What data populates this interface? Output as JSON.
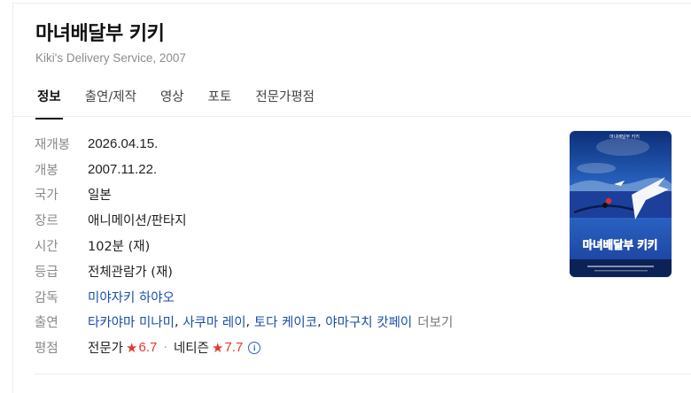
{
  "movie": {
    "title": "마녀배달부 키키",
    "subtitle": "Kiki's Delivery Service, 2007"
  },
  "tabs": [
    {
      "label": "정보",
      "active": true
    },
    {
      "label": "출연/제작",
      "active": false
    },
    {
      "label": "영상",
      "active": false
    },
    {
      "label": "포토",
      "active": false
    },
    {
      "label": "전문가평점",
      "active": false
    }
  ],
  "info": {
    "rerelease": {
      "label": "재개봉",
      "value": "2026.04.15."
    },
    "release": {
      "label": "개봉",
      "value": "2007.11.22."
    },
    "country": {
      "label": "국가",
      "value": "일본"
    },
    "genre": {
      "label": "장르",
      "value": "애니메이션/판타지"
    },
    "runtime": {
      "label": "시간",
      "value": "102분 (재)"
    },
    "rating": {
      "label": "등급",
      "value": "전체관람가 (재)"
    },
    "director": {
      "label": "감독",
      "value": "미야자키 하야오"
    },
    "cast": {
      "label": "출연",
      "names": [
        "타카야마 미나미",
        "사쿠마 레이",
        "토다 케이코",
        "야마구치 캇페이"
      ],
      "separator": ", ",
      "more": "더보기"
    },
    "scores": {
      "label": "평점",
      "critic_label": "전문가",
      "critic_score": "6.7",
      "separator": "·",
      "netizen_label": "네티즌",
      "netizen_score": "7.7",
      "star": "★",
      "info_glyph": "i"
    }
  },
  "poster": {
    "top_text": "마녀배달부 키키",
    "big_title": "마녀배달부 키키",
    "colors": {
      "sky": "#2f6fd0",
      "sea": "#1d3f9c",
      "title": "#e8338a"
    }
  }
}
